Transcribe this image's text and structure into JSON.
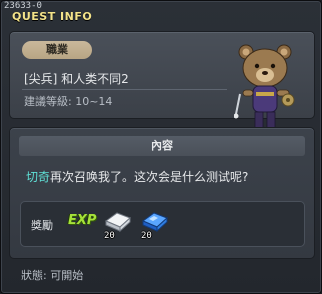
{
  "header": {
    "quest_id": "23633-0",
    "title": "QUEST INFO"
  },
  "job": {
    "badge_label": "職業",
    "name": "[尖兵] 和人类不同2",
    "level_requirement": "建議等級: 10~14"
  },
  "content": {
    "header_label": "內容",
    "npc_name": "切奇",
    "text_rest": "再次召唤我了。这次会是什么测试呢?"
  },
  "rewards": {
    "label": "獎勵",
    "exp_icon_text": "EXP",
    "items": [
      {
        "icon": "white-gem-icon",
        "count": "20"
      },
      {
        "icon": "blue-gem-icon",
        "count": "20"
      }
    ]
  },
  "status": {
    "text": "狀態: 可開始"
  },
  "npc": {
    "icon": "teddy-bear-npc-icon"
  }
}
